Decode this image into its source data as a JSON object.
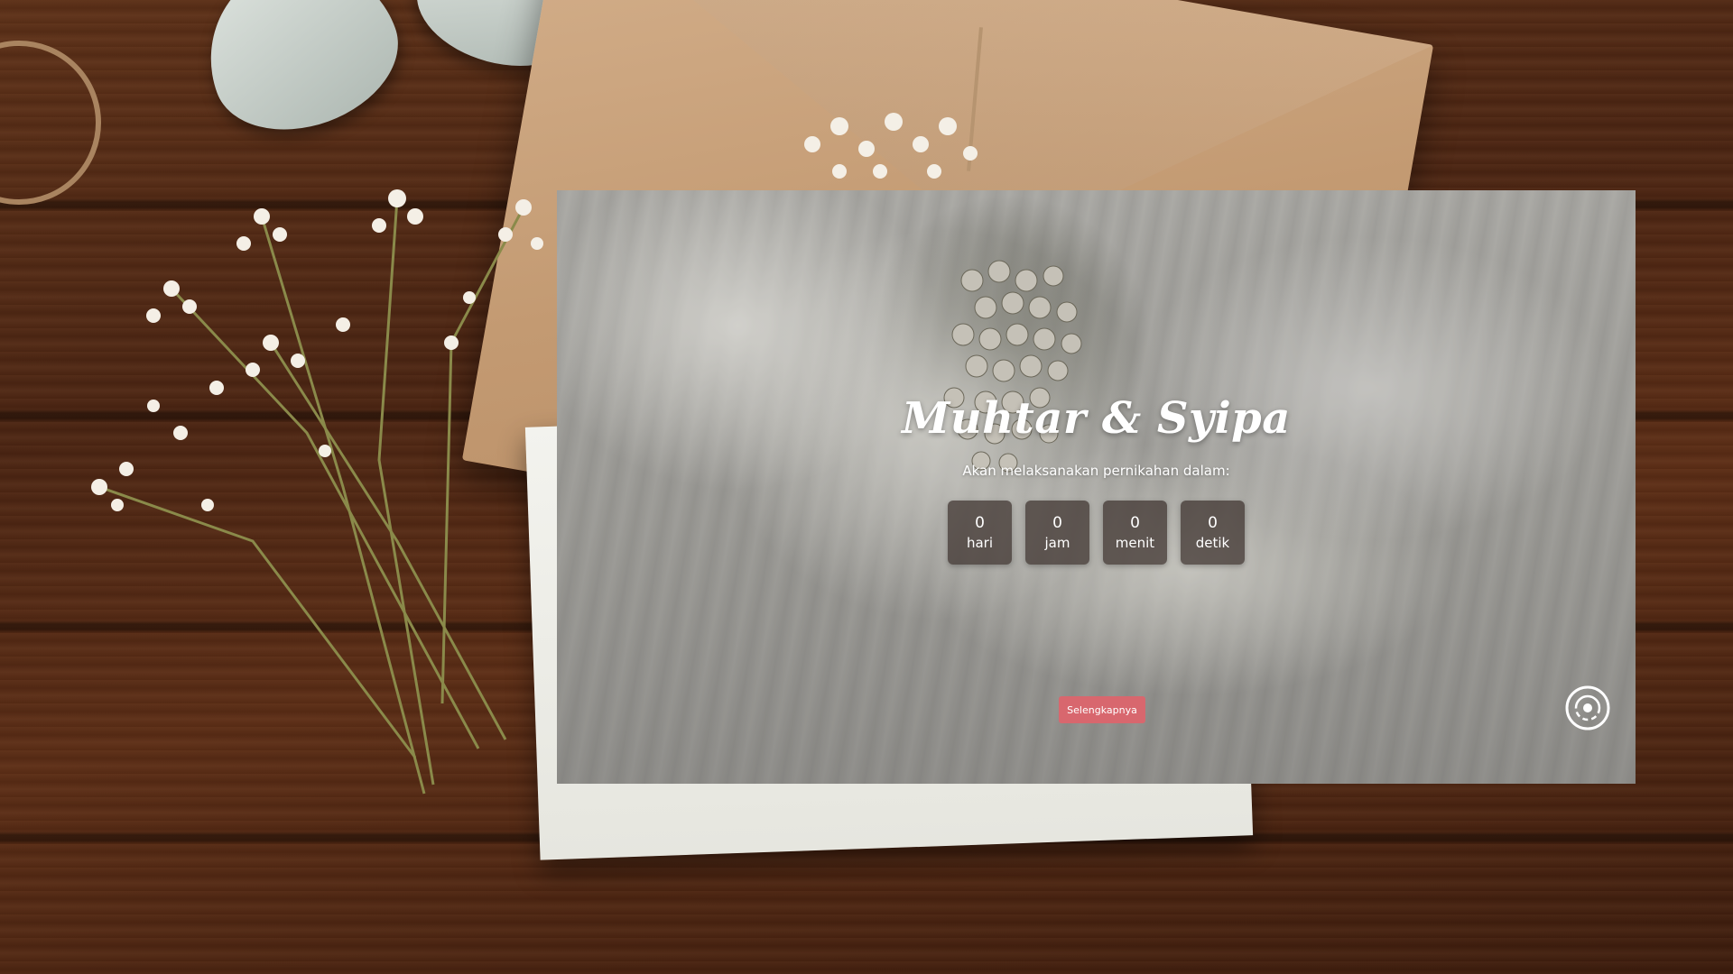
{
  "hero": {
    "couple_names": "Muhtar & Syipa",
    "subtitle": "Akan melaksanakan pernikahan dalam:",
    "countdown": [
      {
        "value": "0",
        "unit": "hari"
      },
      {
        "value": "0",
        "unit": "jam"
      },
      {
        "value": "0",
        "unit": "menit"
      },
      {
        "value": "0",
        "unit": "detik"
      }
    ],
    "more_button_label": "Selengkapnya",
    "music_icon": "disc-icon"
  },
  "colors": {
    "accent_button": "#d8676e",
    "countdown_box": "rgba(60,48,44,0.72)",
    "text": "#ffffff"
  }
}
